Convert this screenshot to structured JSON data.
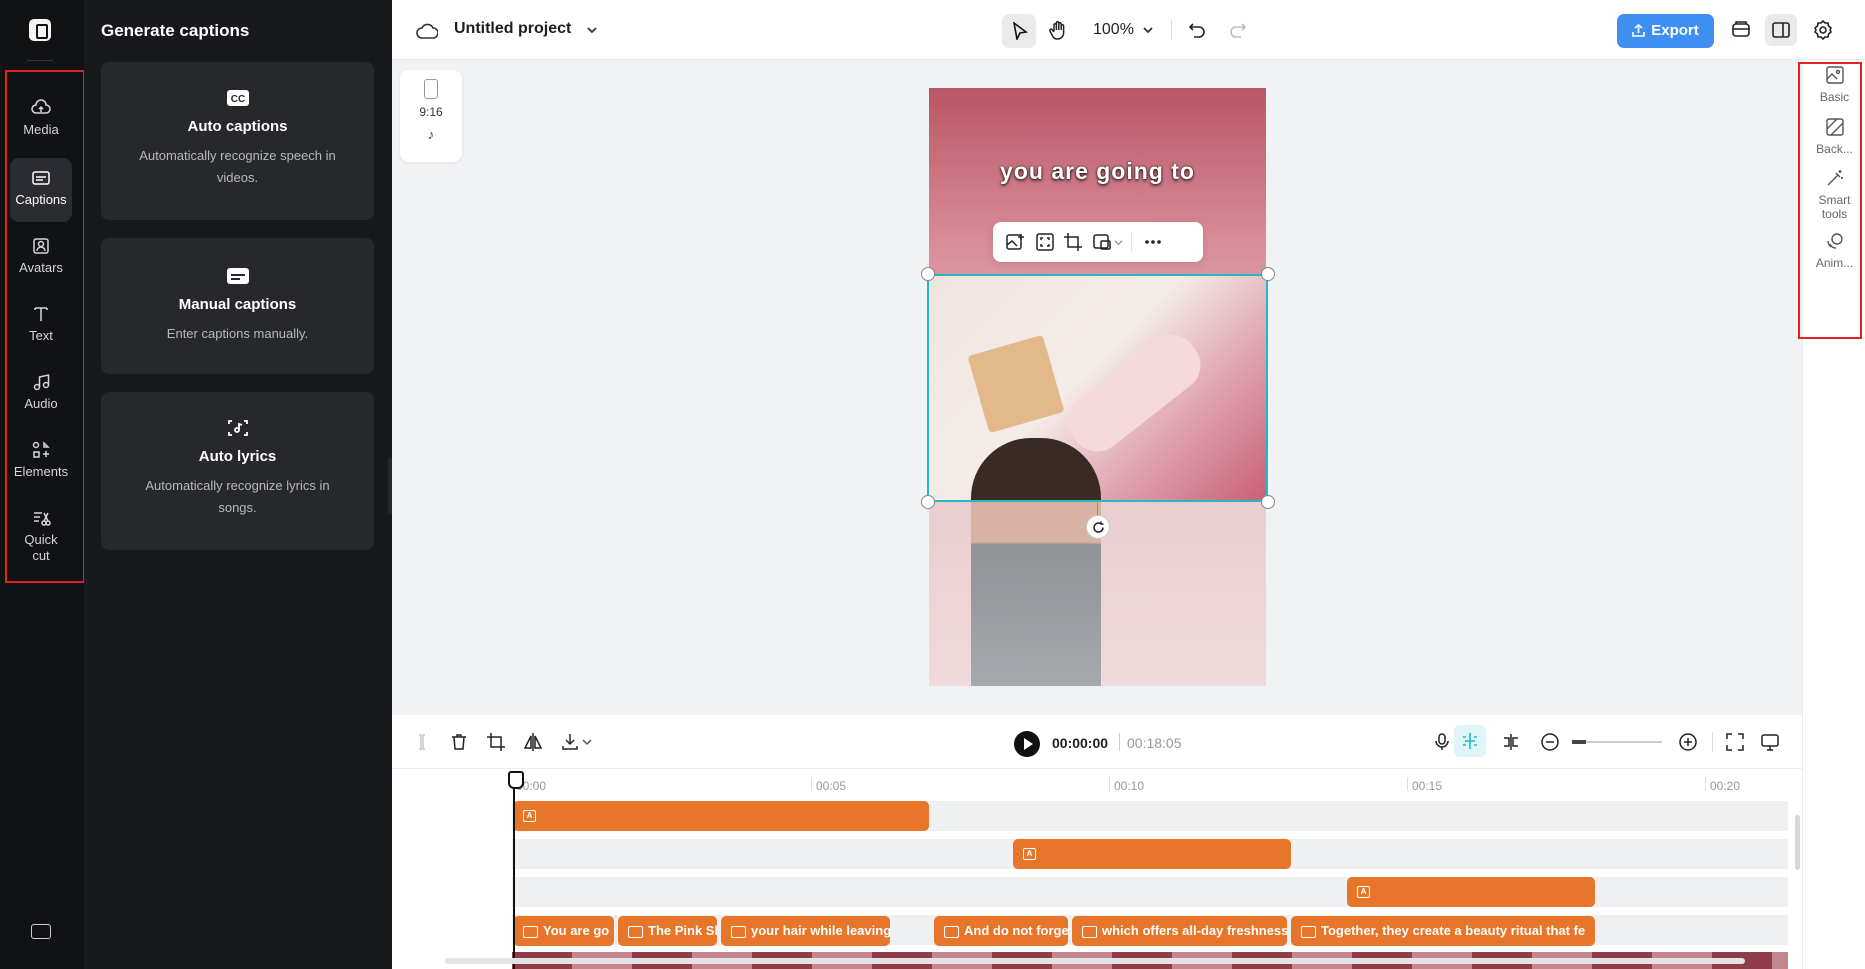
{
  "rail": {
    "items": [
      {
        "label": "Media",
        "icon": "cloud-upload-icon"
      },
      {
        "label": "Captions",
        "icon": "captions-icon"
      },
      {
        "label": "Avatars",
        "icon": "avatar-icon"
      },
      {
        "label": "Text",
        "icon": "text-icon"
      },
      {
        "label": "Audio",
        "icon": "music-note-icon"
      },
      {
        "label": "Elements",
        "icon": "elements-icon"
      },
      {
        "label": "Quick",
        "label2": "cut",
        "icon": "scissors-icon"
      }
    ],
    "active": "Captions"
  },
  "panel": {
    "title": "Generate captions",
    "cards": [
      {
        "title": "Auto captions",
        "desc": "Automatically recognize speech in videos.",
        "icon": "cc-icon"
      },
      {
        "title": "Manual captions",
        "desc": "Enter captions manually.",
        "icon": "caption-box-icon"
      },
      {
        "title": "Auto lyrics",
        "desc": "Automatically recognize lyrics in songs.",
        "icon": "lyrics-icon"
      }
    ]
  },
  "topbar": {
    "project_name": "Untitled project",
    "zoom": "100%",
    "export_label": "Export"
  },
  "canvas": {
    "ratio": "9:16",
    "caption_preview": "you are going to"
  },
  "right_rail": {
    "items": [
      {
        "label": "Basic",
        "icon": "image-icon"
      },
      {
        "label": "Back...",
        "icon": "background-icon"
      },
      {
        "label": "Smart",
        "label2": "tools",
        "icon": "magic-wand-icon"
      },
      {
        "label": "Anim...",
        "icon": "animation-icon"
      }
    ]
  },
  "timeline": {
    "current_time": "00:00:00",
    "total_time": "00:18:05",
    "ticks": [
      "00:00",
      "00:05",
      "00:10",
      "00:15",
      "00:20"
    ],
    "caption_clips": [
      "You are go",
      "The Pink Sh",
      "your hair while leaving it irr",
      "And do not forge",
      "which offers all-day freshness",
      "Together, they create a beauty ritual that fe"
    ]
  },
  "colors": {
    "accent": "#3f8ef2",
    "clip_orange": "#e7762a",
    "selection": "#22b8c4",
    "highlight_box": "#e02222"
  }
}
